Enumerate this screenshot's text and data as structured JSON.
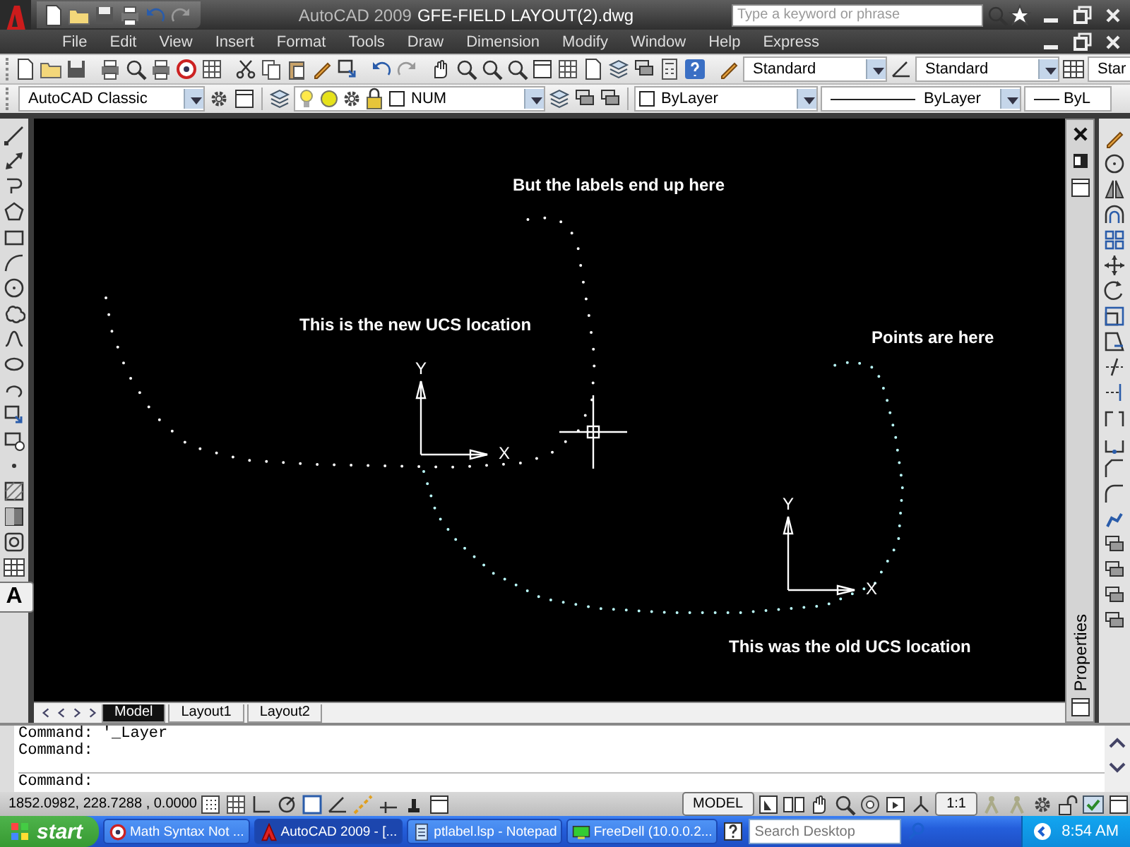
{
  "window": {
    "app_title": "AutoCAD 2009",
    "file_title": "GFE-FIELD LAYOUT(2).dwg",
    "search": {
      "placeholder": "Type a keyword or phrase"
    }
  },
  "menu": [
    "File",
    "Edit",
    "View",
    "Insert",
    "Format",
    "Tools",
    "Draw",
    "Dimension",
    "Modify",
    "Window",
    "Help",
    "Express"
  ],
  "styles_toolbar": {
    "text_style": "Standard",
    "dimension_style": "Standard",
    "table_style": "Star"
  },
  "workspace": "AutoCAD Classic",
  "layer": {
    "name": "NUM"
  },
  "properties_toolbar": {
    "color_setting": "ByLayer",
    "linetype": "ByLayer",
    "lineweight": "ByL"
  },
  "draw_toolbar": {
    "text_tool": "A"
  },
  "canvas": {
    "annotations": [
      {
        "text": "But the labels end up here"
      },
      {
        "text": "This is the new UCS location"
      },
      {
        "text": "Points are here"
      },
      {
        "text": "This was the old UCS location"
      }
    ],
    "ucs_icons": [
      {
        "y_label": "Y",
        "x_label": "X"
      },
      {
        "y_label": "Y",
        "x_label": "X"
      }
    ]
  },
  "layout_tabs": [
    {
      "label": "Model",
      "selected": true
    },
    {
      "label": "Layout1",
      "selected": false
    },
    {
      "label": "Layout2",
      "selected": false
    }
  ],
  "palette": {
    "title": "Properties"
  },
  "command_history": [
    "Command: '_Layer",
    "Command:"
  ],
  "command_prompt": "Command:",
  "status_bar": {
    "coordinates": "1852.0982, 228.7288 , 0.0000",
    "space": "MODEL",
    "annotation_scale": "1:1"
  },
  "taskbar": {
    "start": "start",
    "tasks": [
      {
        "label": "Math Syntax Not ...",
        "selected": false
      },
      {
        "label": "AutoCAD 2009 - [...",
        "selected": true
      },
      {
        "label": "ptlabel.lsp - Notepad",
        "selected": false
      },
      {
        "label": "FreeDell (10.0.0.2...",
        "selected": false
      }
    ],
    "search": {
      "placeholder": "Search Desktop"
    },
    "clock": "8:54 AM"
  }
}
